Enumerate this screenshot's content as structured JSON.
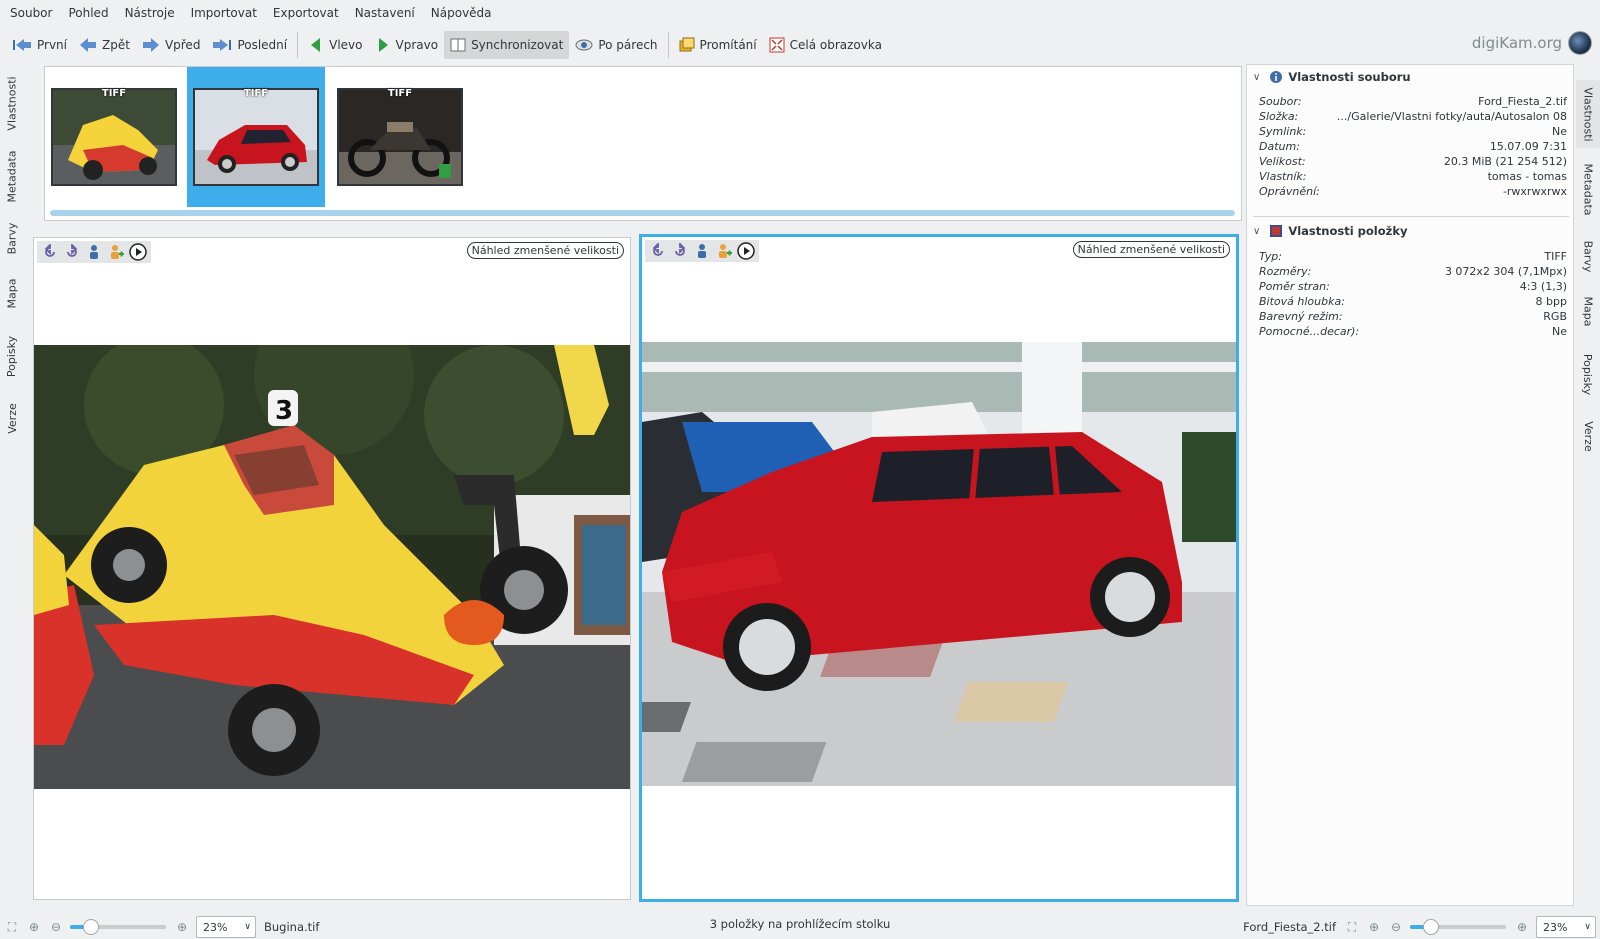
{
  "menu": [
    "Soubor",
    "Pohled",
    "Nástroje",
    "Importovat",
    "Exportovat",
    "Nastavení",
    "Nápověda"
  ],
  "toolbar": {
    "first": "První",
    "back": "Zpět",
    "forward": "Vpřed",
    "last": "Poslední",
    "left": "Vlevo",
    "right": "Vpravo",
    "sync": "Synchronizovat",
    "pairs": "Po párech",
    "slideshow": "Promítání",
    "fullscreen": "Celá obrazovka",
    "brand": "digiKam.org"
  },
  "left_tabs": [
    "Vlastnosti",
    "Metadata",
    "Barvy",
    "Mapa",
    "Popisky",
    "Verze"
  ],
  "right_tabs": [
    "Vlastnosti",
    "Metadata",
    "Barvy",
    "Mapa",
    "Popisky",
    "Verze"
  ],
  "thumbnails": [
    {
      "badge": "TIFF",
      "selected": false
    },
    {
      "badge": "TIFF",
      "selected": true
    },
    {
      "badge": "TIFF",
      "selected": false
    }
  ],
  "panes": {
    "left_label": "Náhled zmenšené velikosti",
    "right_label": "Náhled zmenšené velikosti"
  },
  "sidebar": {
    "file_section": "Vlastnosti souboru",
    "file_props": [
      {
        "k": "Soubor:",
        "v": "Ford_Fiesta_2.tif"
      },
      {
        "k": "Složka:",
        "v": ".../Galerie/Vlastni fotky/auta/Autosalon 08"
      },
      {
        "k": "Symlink:",
        "v": "Ne"
      },
      {
        "k": "Datum:",
        "v": "15.07.09 7:31"
      },
      {
        "k": "Velikost:",
        "v": "20.3 MiB (21 254 512)"
      },
      {
        "k": "Vlastník:",
        "v": "tomas - tomas"
      },
      {
        "k": "Oprávnění:",
        "v": "-rwxrwxrwx"
      }
    ],
    "item_section": "Vlastnosti položky",
    "item_props": [
      {
        "k": "Typ:",
        "v": "TIFF"
      },
      {
        "k": "Rozměry:",
        "v": "3 072x2 304 (7,1Mpx)"
      },
      {
        "k": "Poměr stran:",
        "v": "4:3 (1,3)"
      },
      {
        "k": "Bitová hloubka:",
        "v": "8 bpp"
      },
      {
        "k": "Barevný režim:",
        "v": "RGB"
      },
      {
        "k": "Pomocné...decar):",
        "v": "Ne"
      }
    ]
  },
  "status": {
    "left_zoom": "23%",
    "left_file": "Bugina.tif",
    "center": "3 položky na prohlížecím stolku",
    "right_file": "Ford_Fiesta_2.tif",
    "right_zoom": "23%",
    "left_zoom_level": 0.22,
    "right_zoom_level": 0.22
  }
}
